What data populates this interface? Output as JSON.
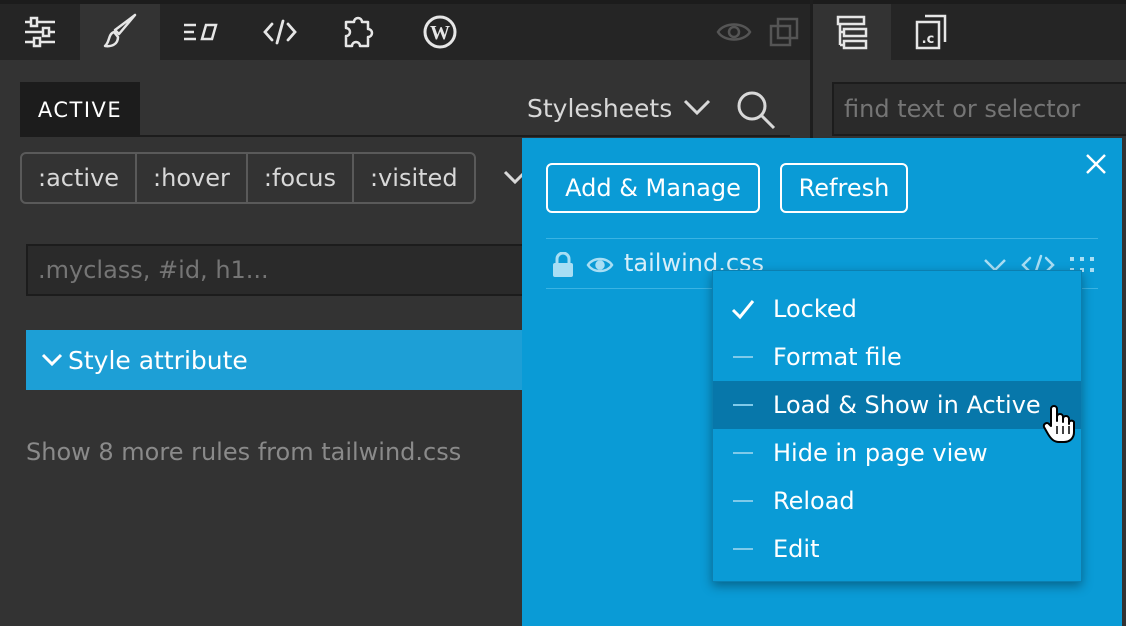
{
  "toolbar": {
    "items": [
      {
        "icon": "sliders-icon"
      },
      {
        "icon": "brush-icon",
        "active": true
      },
      {
        "icon": "list-edit-icon"
      },
      {
        "icon": "code-icon"
      },
      {
        "icon": "puzzle-icon"
      },
      {
        "icon": "wordpress-icon"
      },
      {
        "icon": "eye-icon"
      },
      {
        "icon": "copy-icon"
      },
      {
        "icon": "tree-icon"
      },
      {
        "icon": "css-file-icon"
      }
    ]
  },
  "left_panel": {
    "active_tab": "ACTIVE",
    "stylesheets_label": "Stylesheets",
    "pseudo_states": [
      ":active",
      ":hover",
      ":focus",
      ":visited"
    ],
    "selector_placeholder": ".myclass, #id, h1...",
    "style_attribute_label": "Style attribute",
    "more_rules_text": "Show 8 more rules from tailwind.css"
  },
  "right_panel": {
    "find_placeholder": "find text or selector"
  },
  "popup": {
    "add_manage_label": "Add & Manage",
    "refresh_label": "Refresh",
    "stylesheet_name": "tailwind.css"
  },
  "menu": {
    "items": [
      {
        "label": "Locked",
        "checked": true
      },
      {
        "label": "Format file",
        "checked": false
      },
      {
        "label": "Load & Show in Active",
        "checked": false,
        "highlighted": true
      },
      {
        "label": "Hide in page view",
        "checked": false
      },
      {
        "label": "Reload",
        "checked": false
      },
      {
        "label": "Edit",
        "checked": false
      }
    ]
  },
  "colors": {
    "panel_bg": "#333333",
    "toolbar_bg": "#252525",
    "accent_blue": "#0a9bd6",
    "highlight_blue": "#0777aa",
    "style_attr_blue": "#1d9fd6"
  }
}
